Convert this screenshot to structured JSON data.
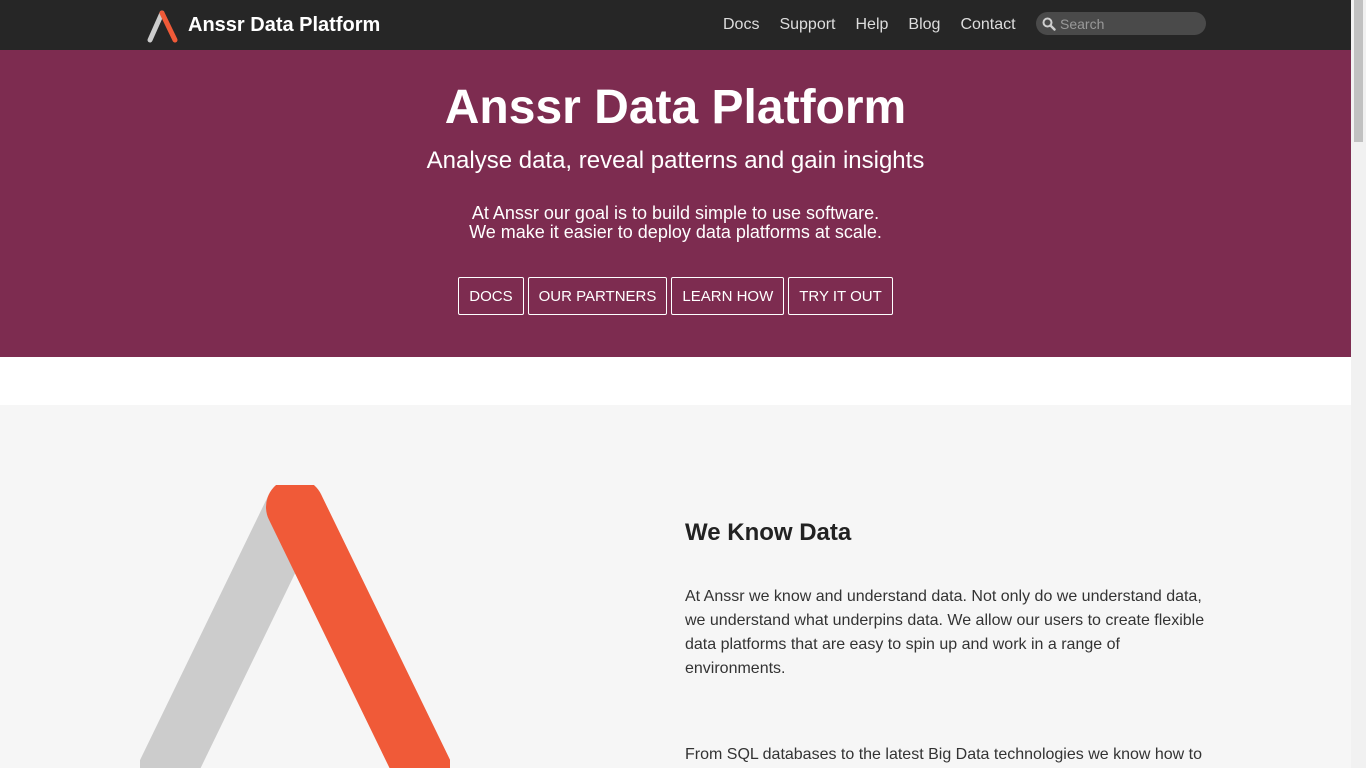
{
  "nav": {
    "brand": "Anssr Data Platform",
    "links": [
      "Docs",
      "Support",
      "Help",
      "Blog",
      "Contact"
    ],
    "search_placeholder": "Search"
  },
  "hero": {
    "title": "Anssr Data Platform",
    "subtitle": "Analyse data, reveal patterns and gain insights",
    "desc_line1": "At Anssr our goal is to build simple to use software.",
    "desc_line2": "We make it easier to deploy data platforms at scale.",
    "buttons": [
      "DOCS",
      "OUR PARTNERS",
      "LEARN HOW",
      "TRY IT OUT"
    ]
  },
  "feature": {
    "title": "We Know Data",
    "paragraph1": "At Anssr we know and understand data. Not only do we understand data, we understand what underpins data. We allow our users to create flexible data platforms that are easy to spin up and work in a range of environments.",
    "paragraph2": "From SQL databases to the latest Big Data technologies we know how to"
  },
  "colors": {
    "navbar": "#262626",
    "hero": "#7d2c50",
    "logo_orange": "#f05a38",
    "logo_gray": "#cccccc",
    "feature_bg": "#f6f6f6"
  },
  "icons": {
    "brand": "anssr-logo-icon",
    "search": "search-icon"
  }
}
